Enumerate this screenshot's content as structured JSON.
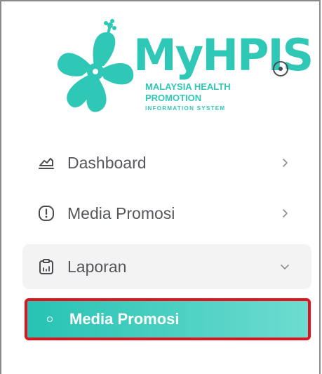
{
  "logo": {
    "title": "MyHPIS",
    "line1": "MALAYSIA HEALTH",
    "line2": "PROMOTION",
    "line3": "INFORMATION SYSTEM",
    "color": "#2fc7b6"
  },
  "sidebar": {
    "items": [
      {
        "label": "Dashboard",
        "icon": "chart-area-icon",
        "chevron": "chevron-right-icon",
        "expanded": false
      },
      {
        "label": "Media Promosi",
        "icon": "alert-icon",
        "chevron": "chevron-right-icon",
        "expanded": false
      },
      {
        "label": "Laporan",
        "icon": "clipboard-report-icon",
        "chevron": "chevron-down-icon",
        "expanded": true
      }
    ],
    "subitems": [
      {
        "label": "Media Promosi",
        "active": true
      }
    ]
  },
  "colors": {
    "accent_start": "#27c3b3",
    "accent_end": "#6ddcd0",
    "highlight_border": "#e0141f",
    "text": "#55575c"
  }
}
